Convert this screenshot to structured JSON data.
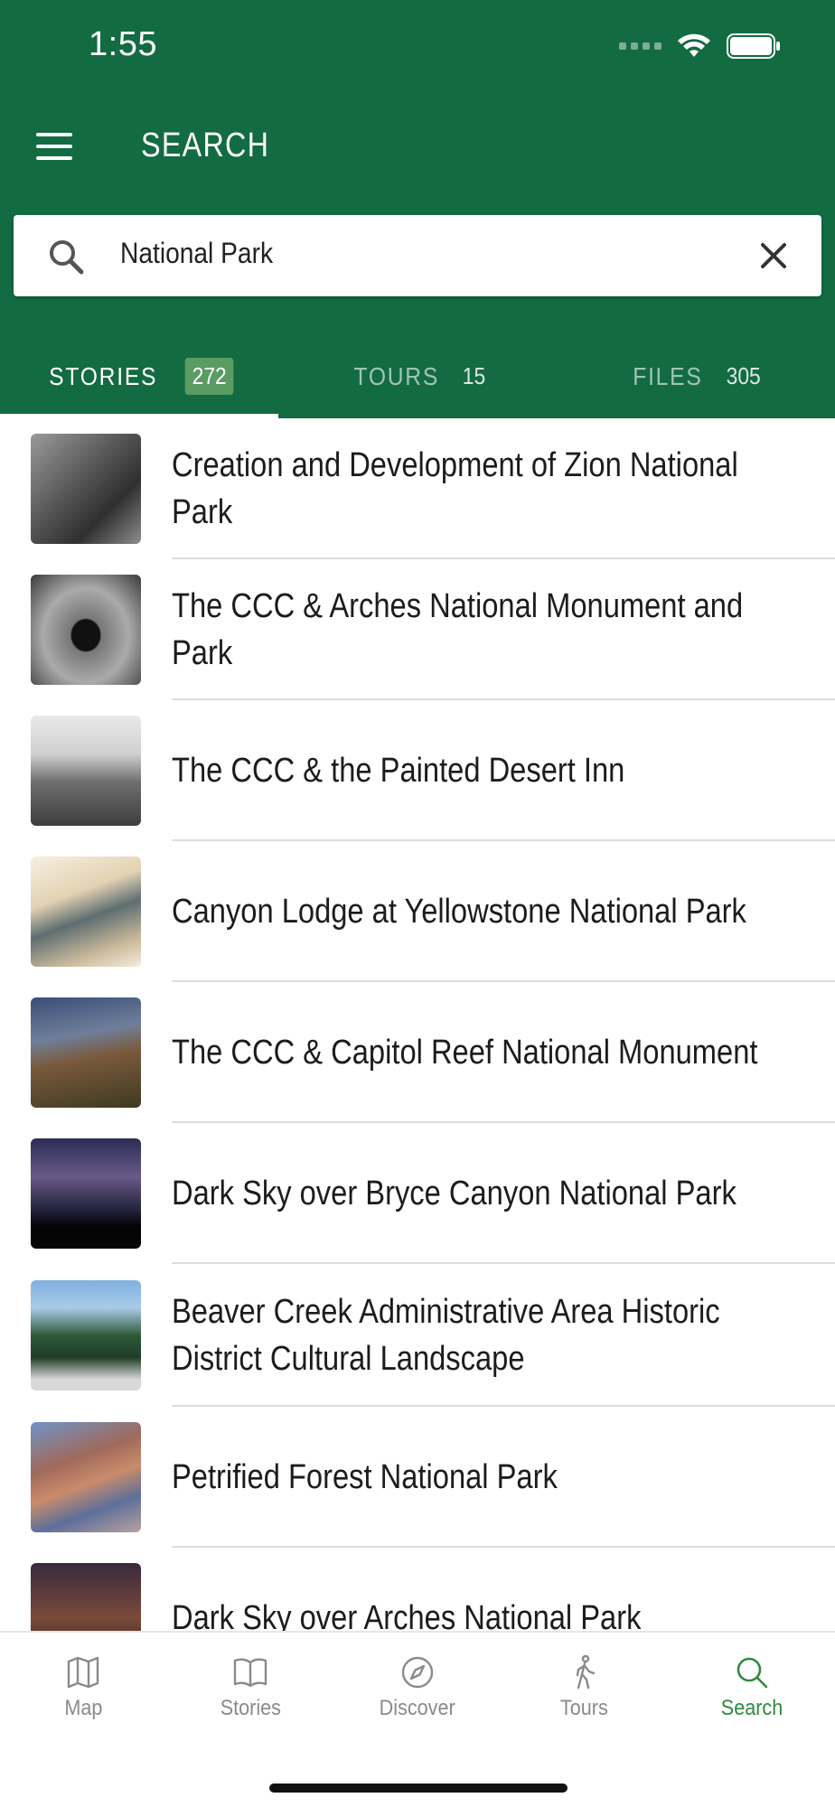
{
  "status_bar": {
    "time": "1:55"
  },
  "header": {
    "title": "SEARCH"
  },
  "search": {
    "value": "National Park",
    "placeholder": ""
  },
  "tabs": [
    {
      "label": "STORIES",
      "count": "272",
      "active": true
    },
    {
      "label": "TOURS",
      "count": "15",
      "active": false
    },
    {
      "label": "FILES",
      "count": "305",
      "active": false
    }
  ],
  "results": [
    {
      "title": "Creation and Development of Zion National Park"
    },
    {
      "title": "The CCC & Arches National Monument and Park"
    },
    {
      "title": "The CCC & the Painted Desert Inn"
    },
    {
      "title": "Canyon Lodge at Yellowstone National Park"
    },
    {
      "title": "The CCC & Capitol Reef National Monument"
    },
    {
      "title": "Dark Sky over Bryce Canyon National Park"
    },
    {
      "title": "Beaver Creek Administrative Area Historic District Cultural Landscape"
    },
    {
      "title": "Petrified Forest National Park"
    },
    {
      "title": "Dark Sky over Arches National Park"
    }
  ],
  "tabbar": [
    {
      "label": "Map",
      "icon": "map-icon"
    },
    {
      "label": "Stories",
      "icon": "book-icon"
    },
    {
      "label": "Discover",
      "icon": "compass-icon"
    },
    {
      "label": "Tours",
      "icon": "walking-icon"
    },
    {
      "label": "Search",
      "icon": "search-icon",
      "active": true
    }
  ],
  "colors": {
    "header": "#136b41",
    "accent": "#2e8a3e",
    "badge": "#5a9c62"
  }
}
